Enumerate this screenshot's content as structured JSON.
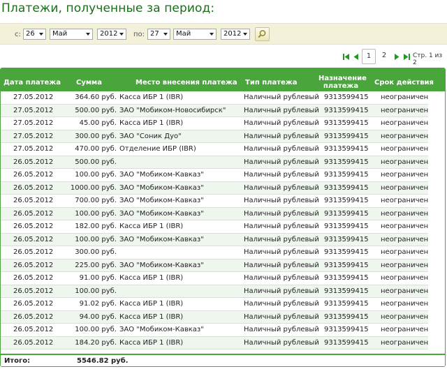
{
  "page": {
    "title": "Платежи, полученные за период:"
  },
  "filter": {
    "from_label": "с:",
    "to_label": "по:",
    "from_day": "26",
    "from_month": "Май",
    "from_year": "2012",
    "to_day": "27",
    "to_month": "Май",
    "to_year": "2012",
    "search_icon": "magnifier-icon"
  },
  "pager": {
    "page1": "1",
    "page2": "2",
    "info": "Стр. 1 из 2",
    "icons": [
      "first-page-icon",
      "prev-page-icon",
      "next-page-icon",
      "last-page-icon"
    ]
  },
  "table": {
    "headers": [
      "Дата платежа",
      "Сумма",
      "Место внесения платежа",
      "Тип платежа",
      "Назначение платежа",
      "Срок действия"
    ],
    "rows": [
      [
        "27.05.2012",
        "364.60 руб.",
        "Касса ИБР 1 (IBR)",
        "Наличный рублевый",
        "9313599415",
        "неограничен"
      ],
      [
        "27.05.2012",
        "500.00 руб.",
        "ЗАО \"Мобиком-Новосибирск\"",
        "Наличный рублевый",
        "9313599415",
        "неограничен"
      ],
      [
        "27.05.2012",
        "45.00 руб.",
        "Касса ИБР 1 (IBR)",
        "Наличный рублевый",
        "9313599415",
        "неограничен"
      ],
      [
        "27.05.2012",
        "300.00 руб.",
        "ЗАО \"Соник Дуо\"",
        "Наличный рублевый",
        "9313599415",
        "неограничен"
      ],
      [
        "27.05.2012",
        "470.00 руб.",
        "Отделение ИБР (IBR)",
        "Наличный рублевый",
        "9313599415",
        "неограничен"
      ],
      [
        "26.05.2012",
        "500.00 руб.",
        "",
        "Наличный рублевый",
        "9313599415",
        "неограничен"
      ],
      [
        "26.05.2012",
        "100.00 руб.",
        "ЗАО \"Мобиком-Кавказ\"",
        "Наличный рублевый",
        "9313599415",
        "неограничен"
      ],
      [
        "26.05.2012",
        "1000.00 руб.",
        "ЗАО \"Мобиком-Кавказ\"",
        "Наличный рублевый",
        "9313599415",
        "неограничен"
      ],
      [
        "26.05.2012",
        "700.00 руб.",
        "ЗАО \"Мобиком-Кавказ\"",
        "Наличный рублевый",
        "9313599415",
        "неограничен"
      ],
      [
        "26.05.2012",
        "100.00 руб.",
        "ЗАО \"Мобиком-Кавказ\"",
        "Наличный рублевый",
        "9313599415",
        "неограничен"
      ],
      [
        "26.05.2012",
        "182.00 руб.",
        "Касса ИБР 1 (IBR)",
        "Наличный рублевый",
        "9313599415",
        "неограничен"
      ],
      [
        "26.05.2012",
        "100.00 руб.",
        "ЗАО \"Мобиком-Кавказ\"",
        "Наличный рублевый",
        "9313599415",
        "неограничен"
      ],
      [
        "26.05.2012",
        "300.00 руб.",
        "",
        "Наличный рублевый",
        "9313599415",
        "неограничен"
      ],
      [
        "26.05.2012",
        "225.00 руб.",
        "ЗАО \"Мобиком-Кавказ\"",
        "Наличный рублевый",
        "9313599415",
        "неограничен"
      ],
      [
        "26.05.2012",
        "91.00 руб.",
        "Касса ИБР 1 (IBR)",
        "Наличный рублевый",
        "9313599415",
        "неограничен"
      ],
      [
        "26.05.2012",
        "100.00 руб.",
        "",
        "Наличный рублевый",
        "9313599415",
        "неограничен"
      ],
      [
        "26.05.2012",
        "91.02 руб.",
        "Касса ИБР 1 (IBR)",
        "Наличный рублевый",
        "9313599415",
        "неограничен"
      ],
      [
        "26.05.2012",
        "94.00 руб.",
        "Касса ИБР 1 (IBR)",
        "Наличный рублевый",
        "9313599415",
        "неограничен"
      ],
      [
        "26.05.2012",
        "100.00 руб.",
        "ЗАО \"Мобиком-Кавказ\"",
        "Наличный рублевый",
        "9313599415",
        "неограничен"
      ],
      [
        "26.05.2012",
        "184.20 руб.",
        "Касса ИБР 1 (IBR)",
        "Наличный рублевый",
        "9313599415",
        "неограничен"
      ]
    ]
  },
  "footer": {
    "total_label": "Итого:",
    "total_value": "5546.82 руб."
  },
  "colors": {
    "accent": "#4aa63c",
    "title": "#1a6e1a",
    "filter_bg": "#f4f1da"
  }
}
